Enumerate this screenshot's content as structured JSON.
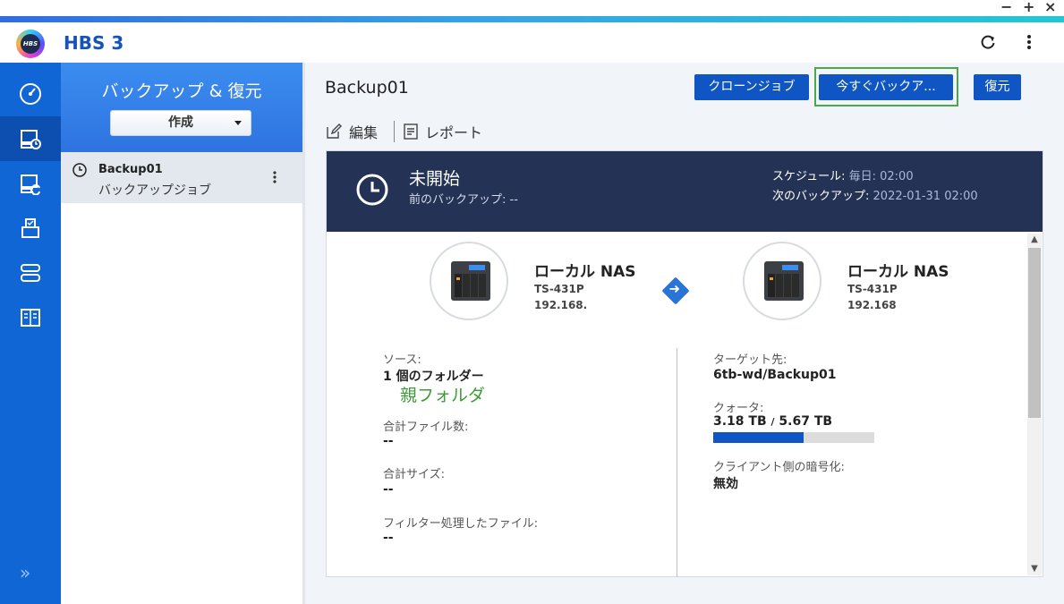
{
  "window": {
    "minimize": "−",
    "maximize": "+",
    "close": "×"
  },
  "app": {
    "title": "HBS 3",
    "logo_text": "HBS"
  },
  "header_icons": [
    "refresh-icon",
    "more-vert-icon"
  ],
  "rail": {
    "items": [
      "dashboard-icon",
      "backup-restore-icon",
      "sync-icon",
      "services-icon",
      "storage-space-icon",
      "logs-icon"
    ],
    "active_index": 1,
    "expand_label": "»"
  },
  "sidebar": {
    "title": "バックアップ & 復元",
    "create_label": "作成",
    "jobs": [
      {
        "name": "Backup01",
        "type": "バックアップジョブ"
      }
    ]
  },
  "main": {
    "job_title": "Backup01",
    "buttons": {
      "clone": "クローンジョブ",
      "backup_now": "今すぐバックア...",
      "restore": "復元"
    },
    "toolbar": {
      "edit": "編集",
      "report": "レポート"
    },
    "status": {
      "title": "未開始",
      "prev_backup_label": "前のバックアップ:",
      "prev_backup_value": "--",
      "schedule_label": "スケジュール:",
      "schedule_value": "毎日: 02:00",
      "next_backup_label": "次のバックアップ:",
      "next_backup_value": "2022-01-31 02:00"
    },
    "source_nas": {
      "name": "ローカル NAS",
      "model": "TS-431P",
      "ip": "192.168."
    },
    "target_nas": {
      "name": "ローカル NAS",
      "model": "TS-431P",
      "ip": "192.168"
    },
    "source": {
      "label": "ソース:",
      "folders": "1 個のフォルダー",
      "folder_name": "親フォルダ",
      "total_files_label": "合計ファイル数:",
      "total_files_value": "--",
      "total_size_label": "合計サイズ:",
      "total_size_value": "--",
      "filtered_label": "フィルター処理したファイル:",
      "filtered_value": "--"
    },
    "target": {
      "label": "ターゲット先:",
      "path": "6tb-wd/Backup01",
      "quota_label": "クォータ:",
      "quota_used": "3.18 TB",
      "quota_sep": "/",
      "quota_total": "5.67 TB",
      "quota_fraction": 0.561,
      "encryption_label": "クライアント側の暗号化:",
      "encryption_value": "無効"
    }
  },
  "colors": {
    "accent": "#0f56c4",
    "rail": "#1166d6",
    "header_dark": "#243355",
    "folder_green": "#3f9b3a"
  }
}
